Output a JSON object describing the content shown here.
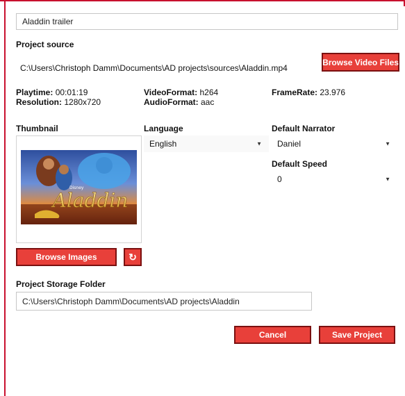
{
  "project_name": "Aladdin trailer",
  "project_source": {
    "label": "Project source",
    "path": "C:\\Users\\Christoph Damm\\Documents\\AD projects\\sources\\Aladdin.mp4",
    "browse_button": "Browse Video Files"
  },
  "video_info": {
    "playtime_label": "Playtime:",
    "playtime": "00:01:19",
    "resolution_label": "Resolution:",
    "resolution": "1280x720",
    "videoformat_label": "VideoFormat:",
    "videoformat": "h264",
    "audioformat_label": "AudioFormat:",
    "audioformat": "aac",
    "framerate_label": "FrameRate:",
    "framerate": "23.976"
  },
  "thumbnail": {
    "label": "Thumbnail",
    "image_title": "Aladdin",
    "browse_button": "Browse Images",
    "refresh_icon": "refresh-icon"
  },
  "language": {
    "label": "Language",
    "selected": "English"
  },
  "narrator": {
    "label": "Default Narrator",
    "selected": "Daniel"
  },
  "speed": {
    "label": "Default Speed",
    "selected": "0"
  },
  "storage": {
    "label": "Project Storage Folder",
    "path": "C:\\Users\\Christoph Damm\\Documents\\AD projects\\Aladdin"
  },
  "actions": {
    "cancel": "Cancel",
    "save": "Save Project"
  },
  "colors": {
    "accent": "#e8403a",
    "frame": "#c8102e"
  }
}
